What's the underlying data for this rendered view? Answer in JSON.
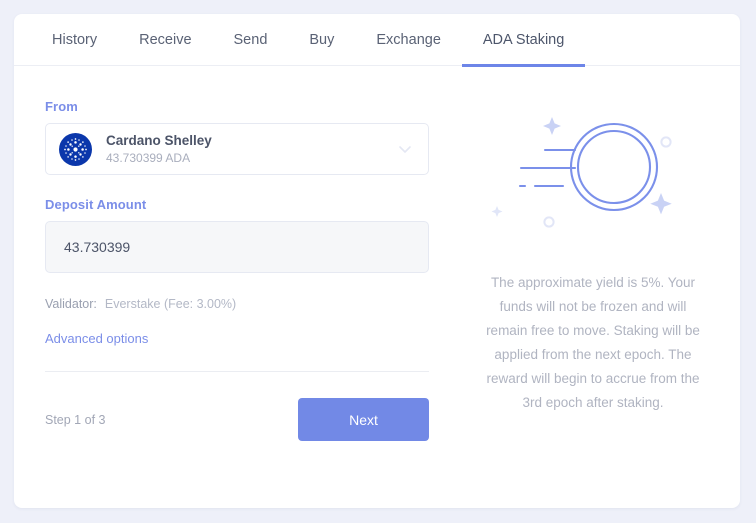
{
  "tabs": [
    {
      "label": "History",
      "active": false
    },
    {
      "label": "Receive",
      "active": false
    },
    {
      "label": "Send",
      "active": false
    },
    {
      "label": "Buy",
      "active": false
    },
    {
      "label": "Exchange",
      "active": false
    },
    {
      "label": "ADA Staking",
      "active": true
    }
  ],
  "form": {
    "from_label": "From",
    "account": {
      "name": "Cardano Shelley",
      "balance": "43.730399 ADA",
      "logo_icon": "cardano-icon"
    },
    "chevron_icon": "chevron-down-icon",
    "deposit_label": "Deposit Amount",
    "deposit_value": "43.730399",
    "deposit_placeholder": "0",
    "validator_label": "Validator:",
    "validator_value": "Everstake (Fee: 3.00%)",
    "advanced_options_label": "Advanced options"
  },
  "footer": {
    "step_text": "Step 1 of 3",
    "next_label": "Next"
  },
  "info": {
    "illustration_icon": "staking-coin-illustration",
    "description": "The approximate yield is 5%. Your funds will not be frozen and will remain free to move. Staking will be applied from the next epoch. The reward will begin to accrue from the 3rd epoch after staking."
  },
  "colors": {
    "accent": "#7289e6",
    "accent_light": "#7b8ee8",
    "page_bg": "#eef0f9",
    "card_bg": "#ffffff",
    "cardano_blue": "#0b37ab",
    "muted_text": "#b0b4c1"
  }
}
